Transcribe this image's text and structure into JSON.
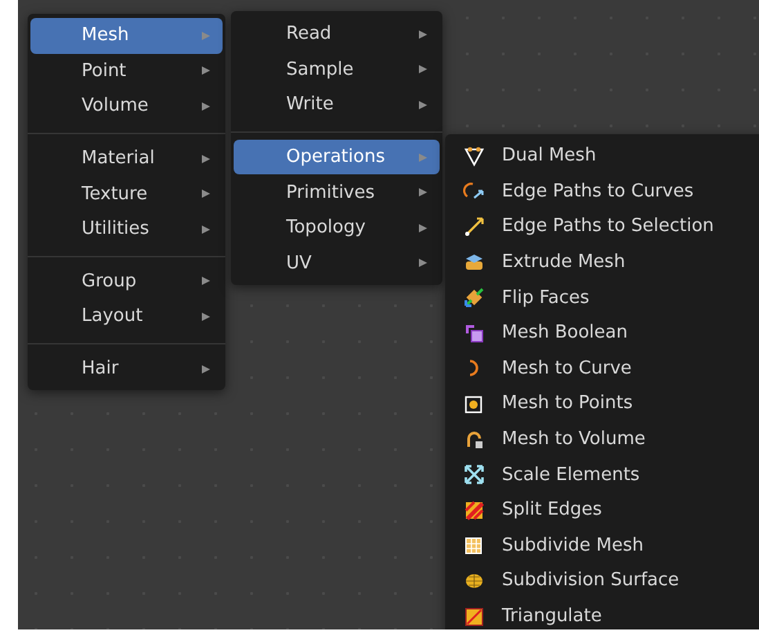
{
  "menus": [
    {
      "groups": [
        [
          {
            "label": "Mesh",
            "selected": true,
            "submenu": true
          },
          {
            "label": "Point",
            "selected": false,
            "submenu": true
          },
          {
            "label": "Volume",
            "selected": false,
            "submenu": true
          }
        ],
        [
          {
            "label": "Material",
            "selected": false,
            "submenu": true
          },
          {
            "label": "Texture",
            "selected": false,
            "submenu": true
          },
          {
            "label": "Utilities",
            "selected": false,
            "submenu": true
          }
        ],
        [
          {
            "label": "Group",
            "selected": false,
            "submenu": true
          },
          {
            "label": "Layout",
            "selected": false,
            "submenu": true
          }
        ],
        [
          {
            "label": "Hair",
            "selected": false,
            "submenu": true
          }
        ]
      ]
    },
    {
      "groups": [
        [
          {
            "label": "Read",
            "selected": false,
            "submenu": true
          },
          {
            "label": "Sample",
            "selected": false,
            "submenu": true
          },
          {
            "label": "Write",
            "selected": false,
            "submenu": true
          }
        ],
        [
          {
            "label": "Operations",
            "selected": true,
            "submenu": true
          },
          {
            "label": "Primitives",
            "selected": false,
            "submenu": true
          },
          {
            "label": "Topology",
            "selected": false,
            "submenu": true
          },
          {
            "label": "UV",
            "selected": false,
            "submenu": true
          }
        ]
      ]
    },
    {
      "groups": [
        [
          {
            "label": "Dual Mesh",
            "selected": false,
            "submenu": false
          },
          {
            "label": "Edge Paths to Curves",
            "selected": false,
            "submenu": false
          },
          {
            "label": "Edge Paths to Selection",
            "selected": false,
            "submenu": false
          },
          {
            "label": "Extrude Mesh",
            "selected": false,
            "submenu": false
          },
          {
            "label": "Flip Faces",
            "selected": false,
            "submenu": false
          },
          {
            "label": "Mesh Boolean",
            "selected": false,
            "submenu": false
          },
          {
            "label": "Mesh to Curve",
            "selected": false,
            "submenu": false
          },
          {
            "label": "Mesh to Points",
            "selected": false,
            "submenu": false
          },
          {
            "label": "Mesh to Volume",
            "selected": false,
            "submenu": false
          },
          {
            "label": "Scale Elements",
            "selected": false,
            "submenu": false
          },
          {
            "label": "Split Edges",
            "selected": false,
            "submenu": false
          },
          {
            "label": "Subdivide Mesh",
            "selected": false,
            "submenu": false
          },
          {
            "label": "Subdivision Surface",
            "selected": false,
            "submenu": false
          },
          {
            "label": "Triangulate",
            "selected": false,
            "submenu": false
          }
        ]
      ]
    }
  ]
}
